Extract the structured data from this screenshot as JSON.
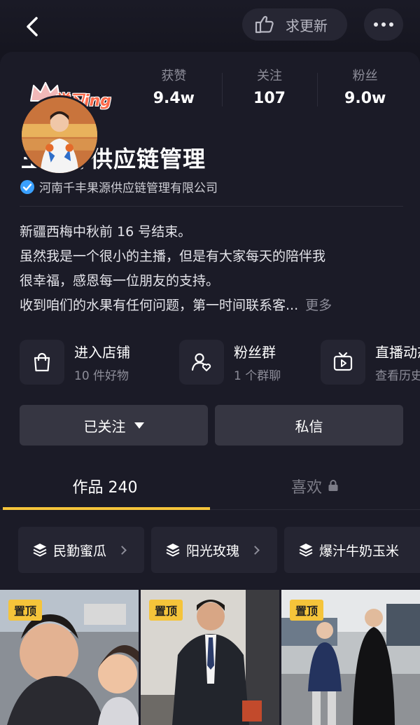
{
  "header": {
    "request_update_label": "求更新",
    "back_icon": "chevron-left-icon",
    "more_icon": "more-dots-icon"
  },
  "profile": {
    "badge": "学习ing",
    "stats": [
      {
        "label": "获赞",
        "value": "9.4w"
      },
      {
        "label": "关注",
        "value": "107"
      },
      {
        "label": "粉丝",
        "value": "9.0w"
      }
    ],
    "name": "王奕婷供应链管理",
    "verified_company": "河南千丰果源供应链管理有限公司",
    "bio_lines": [
      "新疆西梅中秋前 16 号结束。",
      "虽然我是一个很小的主播，但是有大家每天的陪伴我",
      "很幸福，感恩每一位朋友的支持。",
      "收到咱们的水果有任何问题，第一时间联系客..."
    ],
    "bio_more": "更多"
  },
  "shortcuts": [
    {
      "icon": "shopping-bag-icon",
      "title": "进入店铺",
      "subtitle": "10 件好物"
    },
    {
      "icon": "fan-group-icon",
      "title": "粉丝群",
      "subtitle": "1 个群聊"
    },
    {
      "icon": "tv-play-icon",
      "title": "直播动态",
      "subtitle": "查看历史"
    }
  ],
  "actions": {
    "follow_label": "已关注",
    "message_label": "私信"
  },
  "tabs": {
    "works_label": "作品 240",
    "likes_label": "喜欢"
  },
  "collections": [
    {
      "name": "民勤蜜瓜"
    },
    {
      "name": "阳光玫瑰"
    },
    {
      "name": "爆汁牛奶玉米"
    }
  ],
  "posts": [
    {
      "pinned_label": "置顶"
    },
    {
      "pinned_label": "置顶"
    },
    {
      "pinned_label": "置顶"
    }
  ],
  "colors": {
    "background": "#15151f",
    "card": "#1b1b27",
    "accent_yellow": "#f5c43a",
    "verify_blue": "#3aa0ff",
    "button_gray": "#363642"
  }
}
